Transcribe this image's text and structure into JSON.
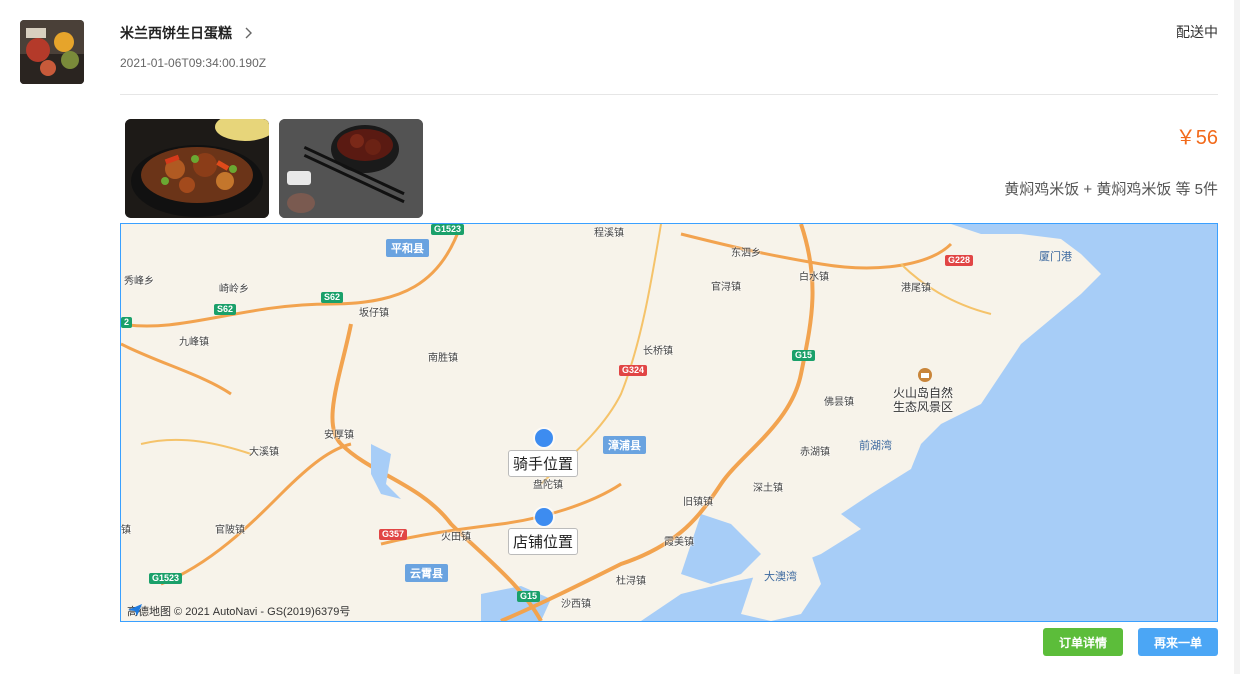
{
  "order": {
    "shop_name": "米兰西饼生日蛋糕",
    "time": "2021-01-06T09:34:00.190Z",
    "status": "配送中",
    "price": "￥56",
    "summary": "黄焖鸡米饭 + 黄焖鸡米饭 等 5件"
  },
  "map": {
    "counties": [
      "平和县",
      "漳浦县",
      "云霄县"
    ],
    "sea_labels": [
      "厦门港",
      "前湖湾",
      "大澳湾"
    ],
    "scenic": [
      "火山岛自然",
      "生态风景区"
    ],
    "towns": [
      "秀峰乡",
      "崎岭乡",
      "坂仔镇",
      "九峰镇",
      "南胜镇",
      "长桥镇",
      "官浔镇",
      "东泗乡",
      "白水镇",
      "港尾镇",
      "佛昙镇",
      "赤湖镇",
      "深土镇",
      "旧镇镇",
      "盘陀镇",
      "安厚镇",
      "大溪镇",
      "官陂镇",
      "火田镇",
      "霞美镇",
      "杜浔镇",
      "沙西镇",
      "程溪镇",
      "镇"
    ],
    "roads": [
      "G1523",
      "S62",
      "S62",
      "G228",
      "G15",
      "G324",
      "G357",
      "G15",
      "G1523",
      "2"
    ],
    "markers": {
      "rider": "骑手位置",
      "shop": "店铺位置"
    },
    "copyright": "高德地图 © 2021 AutoNavi - GS(2019)6379号"
  },
  "actions": {
    "detail": "订单详情",
    "reorder": "再来一单"
  },
  "colors": {
    "price": "#f26a1b",
    "detail_btn": "#5cbd3a",
    "reorder_btn": "#4ba6f5",
    "map_border": "#3aa0ff",
    "sea": "#a7cdf7"
  }
}
